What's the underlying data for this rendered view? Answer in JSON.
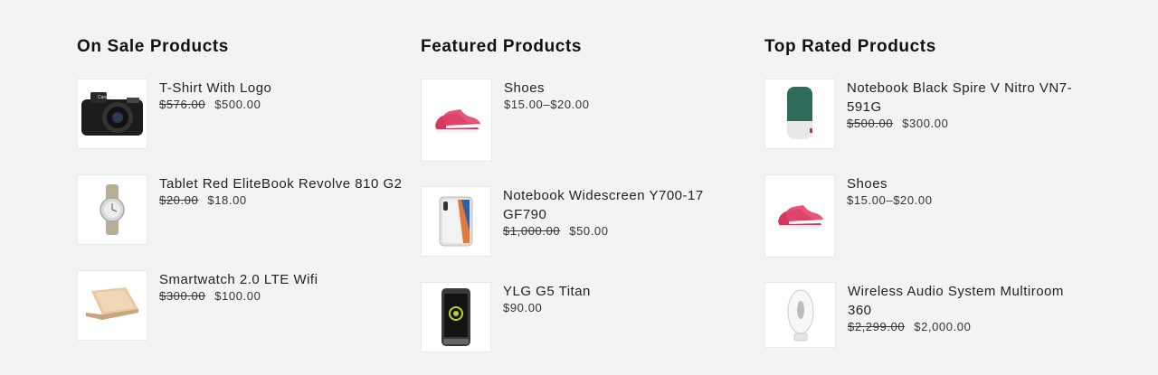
{
  "columns": [
    {
      "title": "On Sale Products",
      "items": [
        {
          "name": "T-Shirt With Logo",
          "old_price": "$576.00",
          "price": "$500.00",
          "icon": "camera-icon"
        },
        {
          "name": "Tablet Red EliteBook Revolve 810 G2",
          "old_price": "$20.00",
          "price": "$18.00",
          "icon": "watch-icon"
        },
        {
          "name": "Smartwatch 2.0 LTE Wifi",
          "old_price": "$300.00",
          "price": "$100.00",
          "icon": "laptop-icon"
        }
      ]
    },
    {
      "title": "Featured Products",
      "items": [
        {
          "name": "Shoes",
          "old_price": "",
          "price": "$15.00–$20.00",
          "icon": "shoes-icon"
        },
        {
          "name": "Notebook Widescreen Y700-17 GF790",
          "old_price": "$1,000.00",
          "price": "$50.00",
          "icon": "phone-icon"
        },
        {
          "name": "YLG G5 Titan",
          "old_price": "",
          "price": "$90.00",
          "icon": "smartphone-icon"
        }
      ]
    },
    {
      "title": "Top Rated Products",
      "items": [
        {
          "name": "Notebook Black Spire V Nitro VN7-591G",
          "old_price": "$500.00",
          "price": "$300.00",
          "icon": "speaker-icon"
        },
        {
          "name": "Shoes",
          "old_price": "",
          "price": "$15.00–$20.00",
          "icon": "shoes-icon"
        },
        {
          "name": "Wireless Audio System Multiroom 360",
          "old_price": "$2,299.00",
          "price": "$2,000.00",
          "icon": "wireless-speaker-icon"
        }
      ]
    }
  ]
}
